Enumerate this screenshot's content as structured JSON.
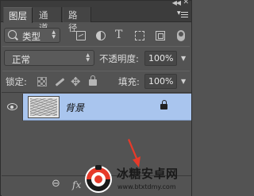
{
  "panel": {
    "tabs": [
      "图层",
      "通道",
      "路径"
    ],
    "collapse_glyph": "◀◀",
    "close_glyph": "✕"
  },
  "filter": {
    "kind_label": "类型",
    "icons": [
      "image-filter-icon",
      "adjustment-filter-icon",
      "type-filter-icon",
      "shape-filter-icon",
      "smart-object-filter-icon",
      "filter-toggle-icon"
    ]
  },
  "blend": {
    "mode": "正常",
    "opacity_label": "不透明度:",
    "opacity_value": "100%"
  },
  "locks": {
    "label": "锁定:",
    "fill_label": "填充:",
    "fill_value": "100%"
  },
  "layers": [
    {
      "name": "背景",
      "visible": true,
      "locked": true,
      "selected": true
    }
  ],
  "footer": {
    "link_glyph": "⊖",
    "fx_label": "fx"
  },
  "watermark": {
    "title": "冰糖安卓网",
    "url": "www.btxtdmy.com"
  },
  "colors": {
    "panel_bg": "#535353",
    "selected_row": "#a9c5ee",
    "arrow": "#e63a2a"
  }
}
